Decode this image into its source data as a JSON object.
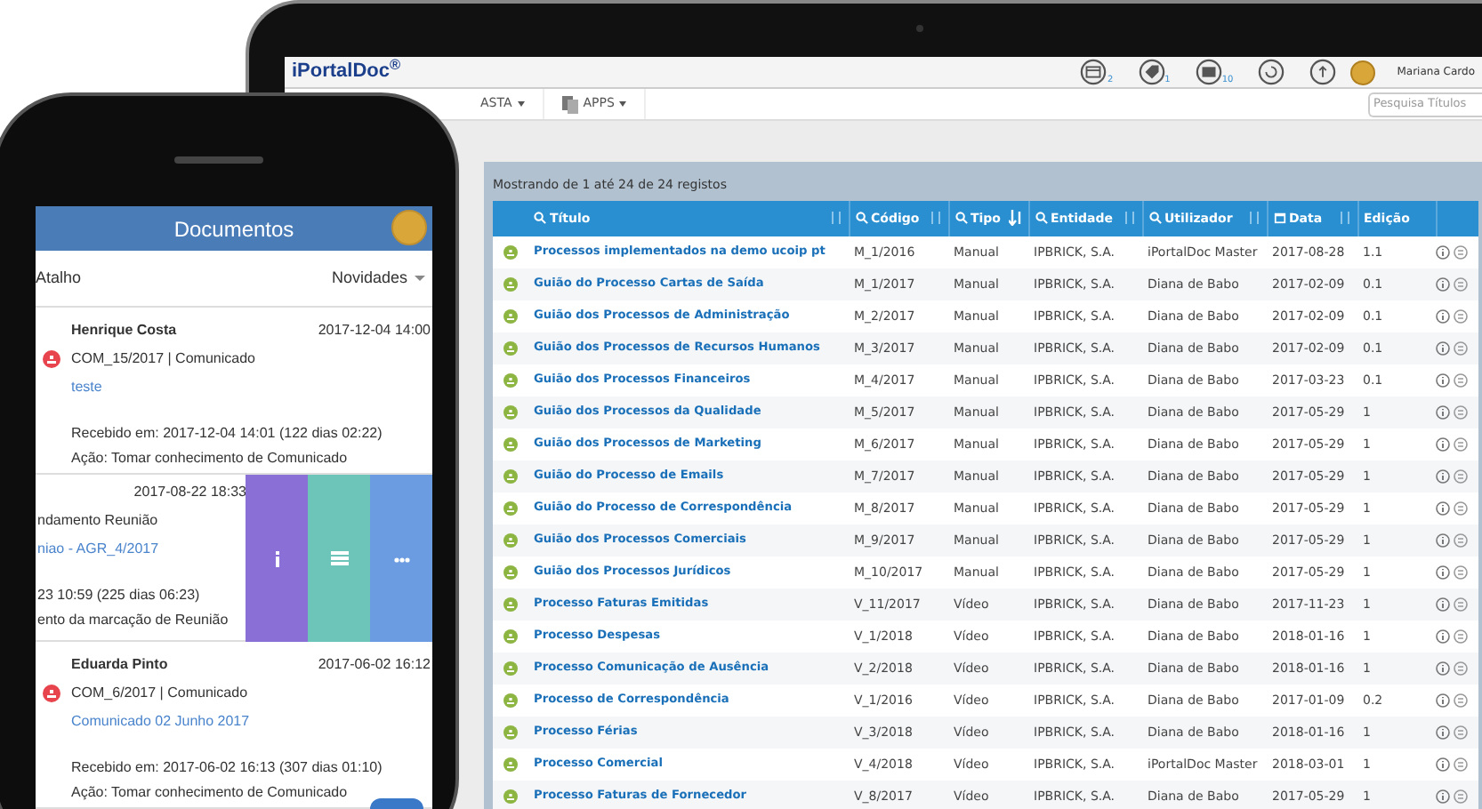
{
  "laptop": {
    "logo": "iPortalDoc$^{®}$",
    "toolbar": [
      {
        "kind": "calendar",
        "count": "2"
      },
      {
        "kind": "tag",
        "count": "1"
      },
      {
        "kind": "mail",
        "count": "10"
      },
      {
        "kind": "history"
      },
      {
        "kind": "upload"
      }
    ],
    "user_name": "Mariana Cardo",
    "menu": [
      {
        "label": "ASTA",
        "kind": "plain"
      },
      {
        "label": "APPS",
        "kind": "apps"
      }
    ],
    "search": {
      "placeholder": "Pesquisa Títulos"
    },
    "table": {
      "summary": "Mostrando de 1 até 24 de 24 registos",
      "columns": [
        {
          "label": "Título",
          "kind": "search",
          "sorted": false
        },
        {
          "label": "Código",
          "kind": "search",
          "sorted": false
        },
        {
          "label": "Tipo",
          "kind": "search",
          "sorted": true
        },
        {
          "label": "Entidade",
          "kind": "search",
          "sorted": false
        },
        {
          "label": "Utilizador",
          "kind": "search",
          "sorted": false
        },
        {
          "label": "Data",
          "kind": "date",
          "sorted": false
        },
        {
          "label": "Edição",
          "kind": "plain"
        }
      ],
      "rows": [
        [
          "Processos implementados na demo ucoip pt",
          "M_1/2016",
          "Manual",
          "IPBRICK, S.A.",
          "iPortalDoc Master",
          "2017-08-28",
          "1.1"
        ],
        [
          "Guião do Processo Cartas de Saída",
          "M_1/2017",
          "Manual",
          "IPBRICK, S.A.",
          "Diana de Babo",
          "2017-02-09",
          "0.1"
        ],
        [
          "Guião dos Processos de Administração",
          "M_2/2017",
          "Manual",
          "IPBRICK, S.A.",
          "Diana de Babo",
          "2017-02-09",
          "0.1"
        ],
        [
          "Guião dos Processos de Recursos Humanos",
          "M_3/2017",
          "Manual",
          "IPBRICK, S.A.",
          "Diana de Babo",
          "2017-02-09",
          "0.1"
        ],
        [
          "Guião dos Processos Financeiros",
          "M_4/2017",
          "Manual",
          "IPBRICK, S.A.",
          "Diana de Babo",
          "2017-03-23",
          "0.1"
        ],
        [
          "Guião dos Processos da Qualidade",
          "M_5/2017",
          "Manual",
          "IPBRICK, S.A.",
          "Diana de Babo",
          "2017-05-29",
          "1"
        ],
        [
          "Guião dos Processos de Marketing",
          "M_6/2017",
          "Manual",
          "IPBRICK, S.A.",
          "Diana de Babo",
          "2017-05-29",
          "1"
        ],
        [
          "Guião do Processo de Emails",
          "M_7/2017",
          "Manual",
          "IPBRICK, S.A.",
          "Diana de Babo",
          "2017-05-29",
          "1"
        ],
        [
          "Guião do Processo de Correspondência",
          "M_8/2017",
          "Manual",
          "IPBRICK, S.A.",
          "Diana de Babo",
          "2017-05-29",
          "1"
        ],
        [
          "Guião dos Processos Comerciais",
          "M_9/2017",
          "Manual",
          "IPBRICK, S.A.",
          "Diana de Babo",
          "2017-05-29",
          "1"
        ],
        [
          "Guião dos Processos Jurídicos",
          "M_10/2017",
          "Manual",
          "IPBRICK, S.A.",
          "Diana de Babo",
          "2017-05-29",
          "1"
        ],
        [
          "Processo Faturas Emitidas",
          "V_11/2017",
          "Vídeo",
          "IPBRICK, S.A.",
          "Diana de Babo",
          "2017-11-23",
          "1"
        ],
        [
          "Processo Despesas",
          "V_1/2018",
          "Vídeo",
          "IPBRICK, S.A.",
          "Diana de Babo",
          "2018-01-16",
          "1"
        ],
        [
          "Processo Comunicação de Ausência",
          "V_2/2018",
          "Vídeo",
          "IPBRICK, S.A.",
          "Diana de Babo",
          "2018-01-16",
          "1"
        ],
        [
          "Processo de Correspondência",
          "V_1/2016",
          "Vídeo",
          "IPBRICK, S.A.",
          "Diana de Babo",
          "2017-01-09",
          "0.2"
        ],
        [
          "Processo Férias",
          "V_3/2018",
          "Vídeo",
          "IPBRICK, S.A.",
          "Diana de Babo",
          "2018-01-16",
          "1"
        ],
        [
          "Processo Comercial",
          "V_4/2018",
          "Vídeo",
          "IPBRICK, S.A.",
          "iPortalDoc Master",
          "2018-03-01",
          "1"
        ],
        [
          "Processo Faturas de Fornecedor",
          "V_8/2017",
          "Vídeo",
          "IPBRICK, S.A.",
          "Diana de Babo",
          "2017-05-29",
          "1"
        ]
      ]
    }
  },
  "phone": {
    "title": "Documentos",
    "filter_left": "Atalho",
    "filter_right": "Novidades",
    "items": [
      {
        "swiped": false,
        "sender": "Henrique Costa",
        "date": "2017-12-04 14:00",
        "reference": "COM_15/2017 | Comunicado",
        "subject": "teste",
        "received": "Recebido em: 2017-12-04 14:01 (122 dias 02:22)",
        "action": "Ação: Tomar conhecimento de Comunicado"
      },
      {
        "swiped": true,
        "date": "2017-08-22 18:33",
        "reference": "ndamento Reunião",
        "subject": "niao - AGR_4/2017",
        "received": "23 10:59 (225 dias 06:23)",
        "action": "ento da marcação de Reunião"
      },
      {
        "swiped": false,
        "sender": "Eduarda Pinto",
        "date": "2017-06-02 16:12",
        "reference": "COM_6/2017 | Comunicado",
        "subject": "Comunicado 02 Junho 2017",
        "received": "Recebido em: 2017-06-02 16:13 (307 dias 01:10)",
        "action": "Ação: Tomar conhecimento de Comunicado"
      }
    ]
  }
}
